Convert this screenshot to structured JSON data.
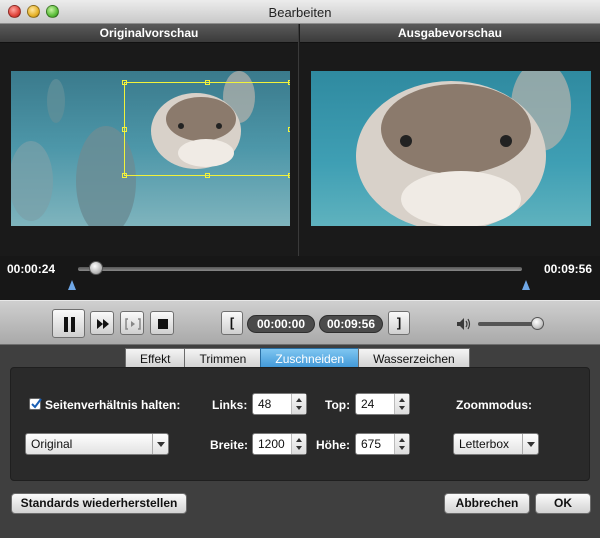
{
  "window": {
    "title": "Bearbeiten"
  },
  "preview": {
    "original_label": "Originalvorschau",
    "output_label": "Ausgabevorschau"
  },
  "timeline": {
    "current_time": "00:00:24",
    "total_time": "00:09:56",
    "position": 0.04
  },
  "controls": {
    "clip_start": "00:00:00",
    "clip_end": "00:09:56",
    "mark_in_label": "[",
    "mark_out_label": "]",
    "volume": 0.9
  },
  "tabs": [
    {
      "label": "Effekt",
      "active": false
    },
    {
      "label": "Trimmen",
      "active": false
    },
    {
      "label": "Zuschneiden",
      "active": true
    },
    {
      "label": "Wasserzeichen",
      "active": false
    }
  ],
  "crop": {
    "keep_aspect_label": "Seitenverhältnis halten:",
    "keep_aspect_checked": true,
    "aspect_select": "Original",
    "left_label": "Links:",
    "left_value": "48",
    "top_label": "Top:",
    "top_value": "24",
    "width_label": "Breite:",
    "width_value": "1200",
    "height_label": "Höhe:",
    "height_value": "675",
    "zoom_label": "Zoommodus:",
    "zoom_select": "Letterbox"
  },
  "buttons": {
    "reset": "Standards wiederherstellen",
    "cancel": "Abbrechen",
    "ok": "OK"
  }
}
